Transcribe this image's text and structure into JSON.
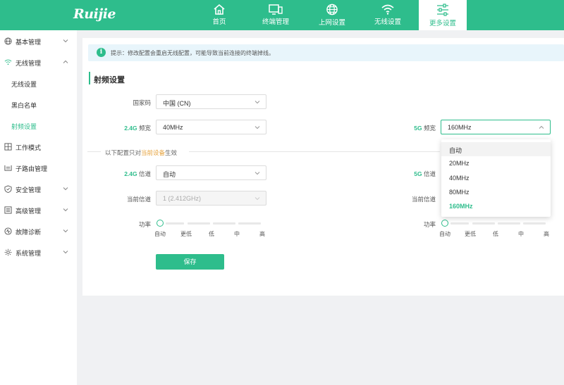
{
  "brand": {
    "logo": "Ruijie"
  },
  "nav": [
    {
      "label": "首页",
      "icon": "home-icon"
    },
    {
      "label": "终端管理",
      "icon": "monitor-icon"
    },
    {
      "label": "上网设置",
      "icon": "globe-icon"
    },
    {
      "label": "无线设置",
      "icon": "wifi-icon"
    },
    {
      "label": "更多设置",
      "icon": "sliders-icon",
      "active": true
    }
  ],
  "sidebar": {
    "items": [
      {
        "label": "基本管理",
        "icon": "globe-icon"
      },
      {
        "label": "无线管理",
        "icon": "wifi-icon"
      },
      {
        "label": "无线设置"
      },
      {
        "label": "黑白名单"
      },
      {
        "label": "射频设置",
        "active": true
      },
      {
        "label": "工作模式",
        "icon": "grid-icon"
      },
      {
        "label": "子路由管理",
        "icon": "router-icon"
      },
      {
        "label": "安全管理",
        "icon": "shield-icon"
      },
      {
        "label": "高级管理",
        "icon": "list-icon"
      },
      {
        "label": "故障诊断",
        "icon": "diagnose-icon"
      },
      {
        "label": "系统管理",
        "icon": "settings-icon"
      }
    ]
  },
  "tip": {
    "icon": "info-icon",
    "text": "提示：修改配置会重启无线配置，可能导致当前连接的终端掉线。"
  },
  "section": {
    "title": "射频设置"
  },
  "form": {
    "country": {
      "label": "国家码",
      "value": "中国 (CN)"
    },
    "bw24": {
      "label_band": "2.4G",
      "label_rest": " 频宽",
      "value": "40MHz"
    },
    "bw5": {
      "label_band": "5G",
      "label_rest": " 频宽",
      "value": "160MHz"
    },
    "divider": {
      "prefix": "以下配置只对",
      "highlight": "当前设备",
      "suffix": "生效"
    },
    "ch24": {
      "label_band": "2.4G",
      "label_rest": " 信道",
      "value": "自动"
    },
    "ch5": {
      "label_band": "5G",
      "label_rest": " 信道"
    },
    "cur24": {
      "label": "当前信道",
      "value": "1  (2.412GHz)"
    },
    "cur5": {
      "label": "当前信道"
    },
    "power": {
      "label": "功率",
      "levels": [
        "自动",
        "更低",
        "低",
        "中",
        "高"
      ],
      "selected": "自动"
    },
    "save": "保存"
  },
  "dropdown": {
    "options": [
      "自动",
      "20MHz",
      "40MHz",
      "80MHz",
      "160MHz"
    ],
    "hovered": "自动",
    "selected": "160MHz"
  },
  "colors": {
    "accent": "#2ebd8c",
    "highlight": "#e6a23c"
  }
}
